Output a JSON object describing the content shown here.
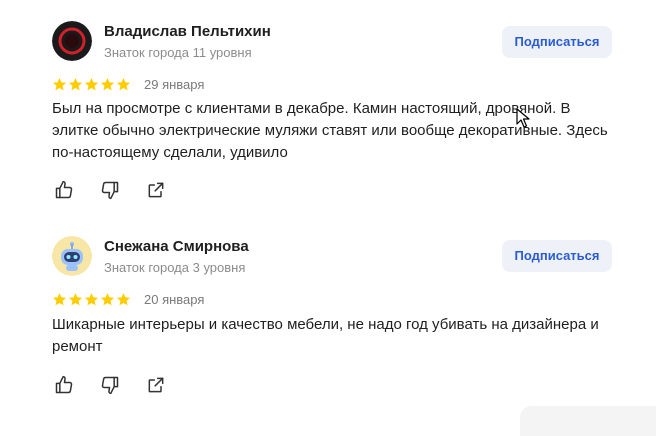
{
  "reviews": [
    {
      "author": "Владислав Пельтихин",
      "level": "Знаток города 11 уровня",
      "subscribe_label": "Подписаться",
      "rating": 5,
      "date": "29 января",
      "text": "Был на просмотре с клиентами в декабре. Камин настоящий, дровяной. В элитке обычно электрические муляжи ставят или вообще декоративные. Здесь по-настоящему сделали, удивило"
    },
    {
      "author": "Снежана Смирнова",
      "level": "Знаток города 3 уровня",
      "subscribe_label": "Подписаться",
      "rating": 5,
      "date": "20 января",
      "text": "Шикарные интерьеры и качество мебели, не надо год убивать на дизайнера и ремонт"
    }
  ],
  "colors": {
    "star": "#fc0",
    "accent": "#2c5cd4",
    "button_bg": "#eef1f7"
  },
  "icons": [
    "like-icon",
    "dislike-icon",
    "share-icon"
  ]
}
